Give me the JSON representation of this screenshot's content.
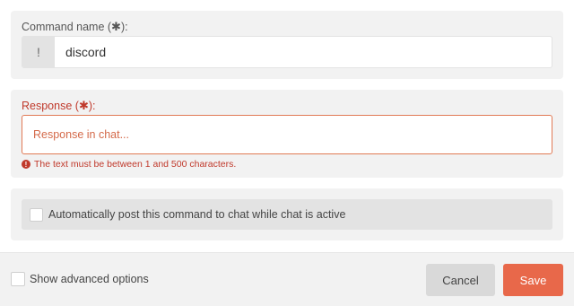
{
  "command": {
    "label_text": "Command name (",
    "required_mark": "✱",
    "label_suffix": "):",
    "prefix": "!",
    "value": "discord"
  },
  "response": {
    "label_text": "Response (",
    "required_mark": "✱",
    "label_suffix": "):",
    "placeholder": "Response in chat...",
    "error_icon": "!",
    "error": "The text must be between 1 and 500 characters."
  },
  "auto_post": {
    "label": "Automatically post this command to chat while chat is active",
    "checked": false
  },
  "footer": {
    "advanced_label": "Show advanced options",
    "advanced_checked": false,
    "cancel_label": "Cancel",
    "save_label": "Save"
  },
  "colors": {
    "accent": "#e8684a",
    "error": "#c0392b",
    "panel": "#f2f2f2"
  }
}
